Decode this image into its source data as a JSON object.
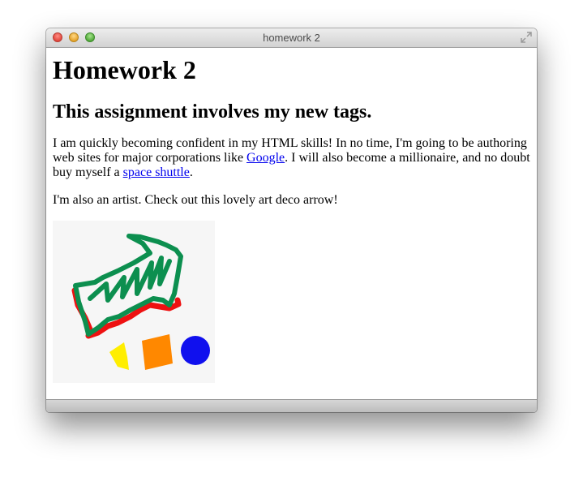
{
  "window": {
    "title": "homework 2"
  },
  "page": {
    "heading": "Homework 2",
    "subheading": "This assignment involves my new tags.",
    "paragraph1": {
      "text1": "I am quickly becoming confident in my HTML skills! In no time, I'm going to be authoring web sites for major corporations like ",
      "link1": "Google",
      "text2": ". I will also become a millionaire, and no doubt buy myself a ",
      "link2": "space shuttle",
      "text3": "."
    },
    "paragraph2": "I'm also an artist. Check out this lovely art deco arrow!",
    "image": {
      "colors": {
        "arrow": "#0c8f4f",
        "shadow": "#ee1111",
        "triangle": "#ffee00",
        "square": "#ff8800",
        "circle": "#1010ee",
        "background": "#f6f6f6"
      }
    }
  }
}
